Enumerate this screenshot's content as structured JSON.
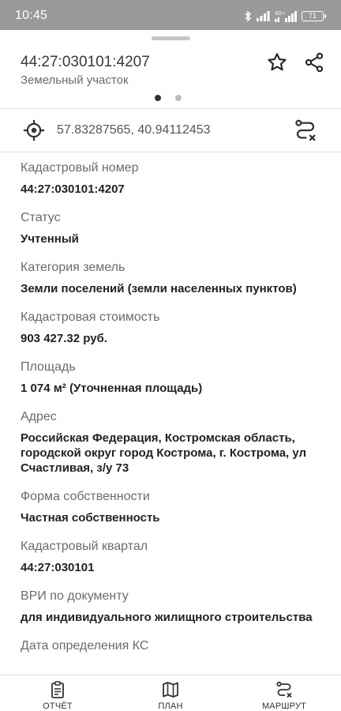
{
  "status_bar": {
    "time": "10:45",
    "network_label": "4G+",
    "battery": "71",
    "icons": [
      "bluetooth-icon",
      "signal-icon",
      "signal-4g-icon",
      "battery-icon"
    ]
  },
  "header": {
    "title": "44:27:030101:4207",
    "subtitle": "Земельный участок",
    "pager": {
      "pages": 2,
      "active": 1
    },
    "actions": [
      "star-icon",
      "share-icon"
    ]
  },
  "location": {
    "coordinates": "57.83287565, 40.94112453",
    "icons": [
      "target-icon",
      "route-icon"
    ]
  },
  "properties": [
    {
      "label": "Кадастровый номер",
      "value": "44:27:030101:4207"
    },
    {
      "label": "Статус",
      "value": "Учтенный"
    },
    {
      "label": "Категория земель",
      "value": "Земли поселений (земли населенных пунктов)"
    },
    {
      "label": "Кадастровая стоимость",
      "value": "903 427.32 руб."
    },
    {
      "label": "Площадь",
      "value": "1 074 м² (Уточненная площадь)"
    },
    {
      "label": "Адрес",
      "value": "Российская Федерация, Костромская область, городской округ город Кострома, г. Кострома, ул Счастливая, з/у 73"
    },
    {
      "label": "Форма собственности",
      "value": "Частная собственность"
    },
    {
      "label": "Кадастровый квартал",
      "value": "44:27:030101"
    },
    {
      "label": "ВРИ по документу",
      "value": "для индивидуального жилищного строительства"
    },
    {
      "label": "Дата определения КС"
    }
  ],
  "bottom_nav": {
    "report": "ОТЧЁТ",
    "plan": "ПЛАН",
    "route": "МАРШРУТ"
  }
}
